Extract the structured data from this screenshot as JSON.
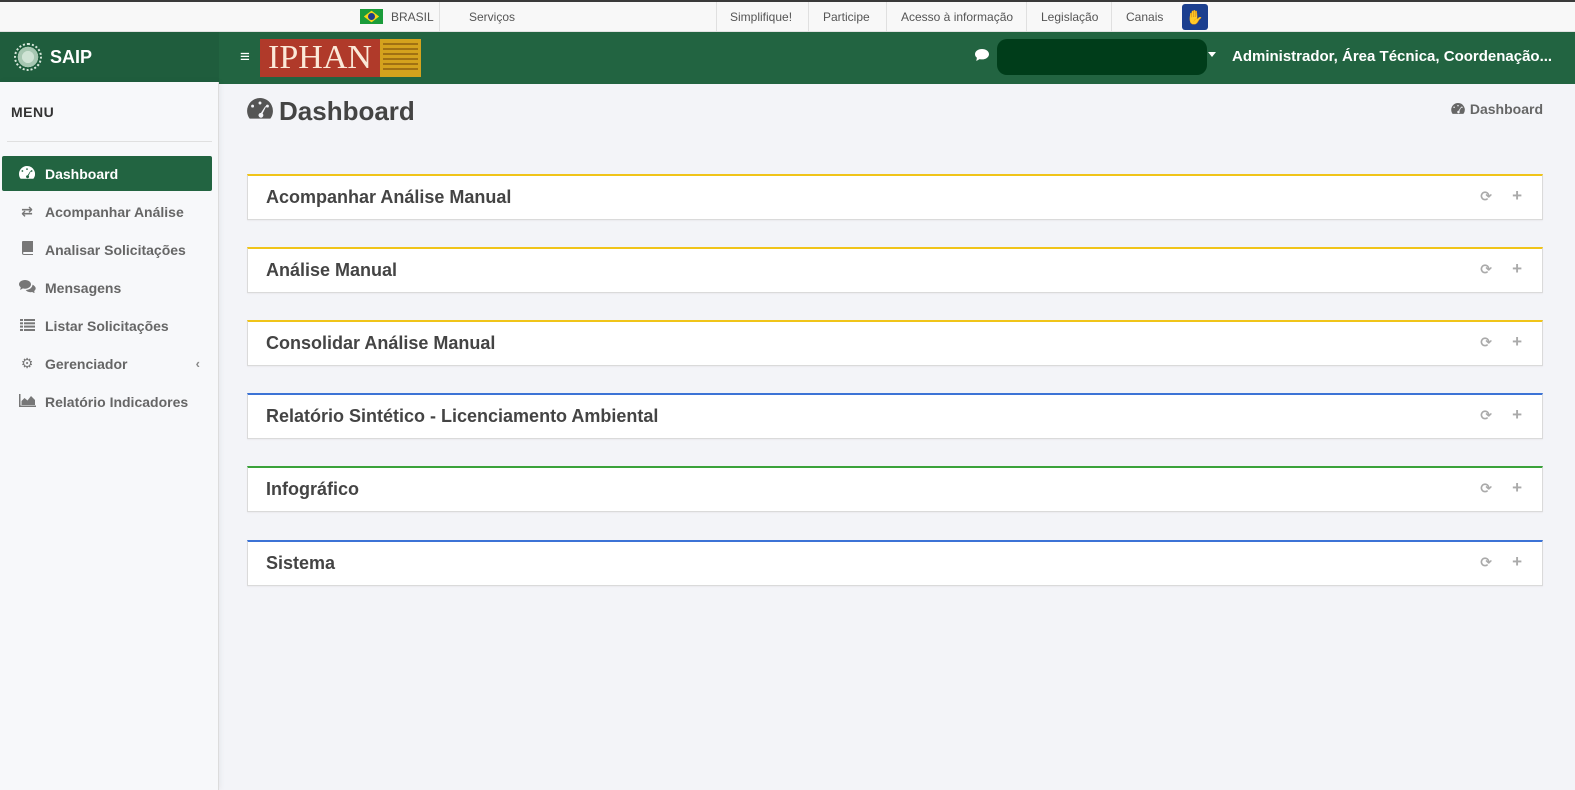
{
  "govbar": {
    "country": "BRASIL",
    "services": "Serviços",
    "links": [
      "Simplifique!",
      "Participe",
      "Acesso à informação",
      "Legislação",
      "Canais"
    ],
    "accessibility_icon": "hand-sign-icon"
  },
  "brand": {
    "name": "SAIP",
    "logo_text": "IPHAN"
  },
  "header": {
    "user_label": "Administrador, Área Técnica, Coordenação..."
  },
  "sidebar": {
    "title": "MENU",
    "items": [
      {
        "label": "Dashboard",
        "icon": "dashboard-icon",
        "active": true
      },
      {
        "label": "Acompanhar Análise",
        "icon": "exchange-icon"
      },
      {
        "label": "Analisar Solicitações",
        "icon": "book-icon"
      },
      {
        "label": "Mensagens",
        "icon": "comments-icon"
      },
      {
        "label": "Listar Solicitações",
        "icon": "list-icon"
      },
      {
        "label": "Gerenciador",
        "icon": "gears-icon",
        "has_submenu": true
      },
      {
        "label": "Relatório Indicadores",
        "icon": "area-chart-icon"
      }
    ]
  },
  "main": {
    "title": "Dashboard",
    "breadcrumb": "Dashboard",
    "boxes": [
      {
        "title": "Acompanhar Análise Manual",
        "color": "#f0c419"
      },
      {
        "title": "Análise Manual",
        "color": "#f0c419"
      },
      {
        "title": "Consolidar Análise Manual",
        "color": "#f0c419"
      },
      {
        "title": "Relatório Sintético - Licenciamento Ambiental",
        "color": "#3c73d6"
      },
      {
        "title": "Infográfico",
        "color": "#3aa23a"
      },
      {
        "title": "Sistema",
        "color": "#3c73d6"
      }
    ]
  },
  "colors": {
    "primary": "#226441",
    "brand": "#1f5d3d"
  }
}
